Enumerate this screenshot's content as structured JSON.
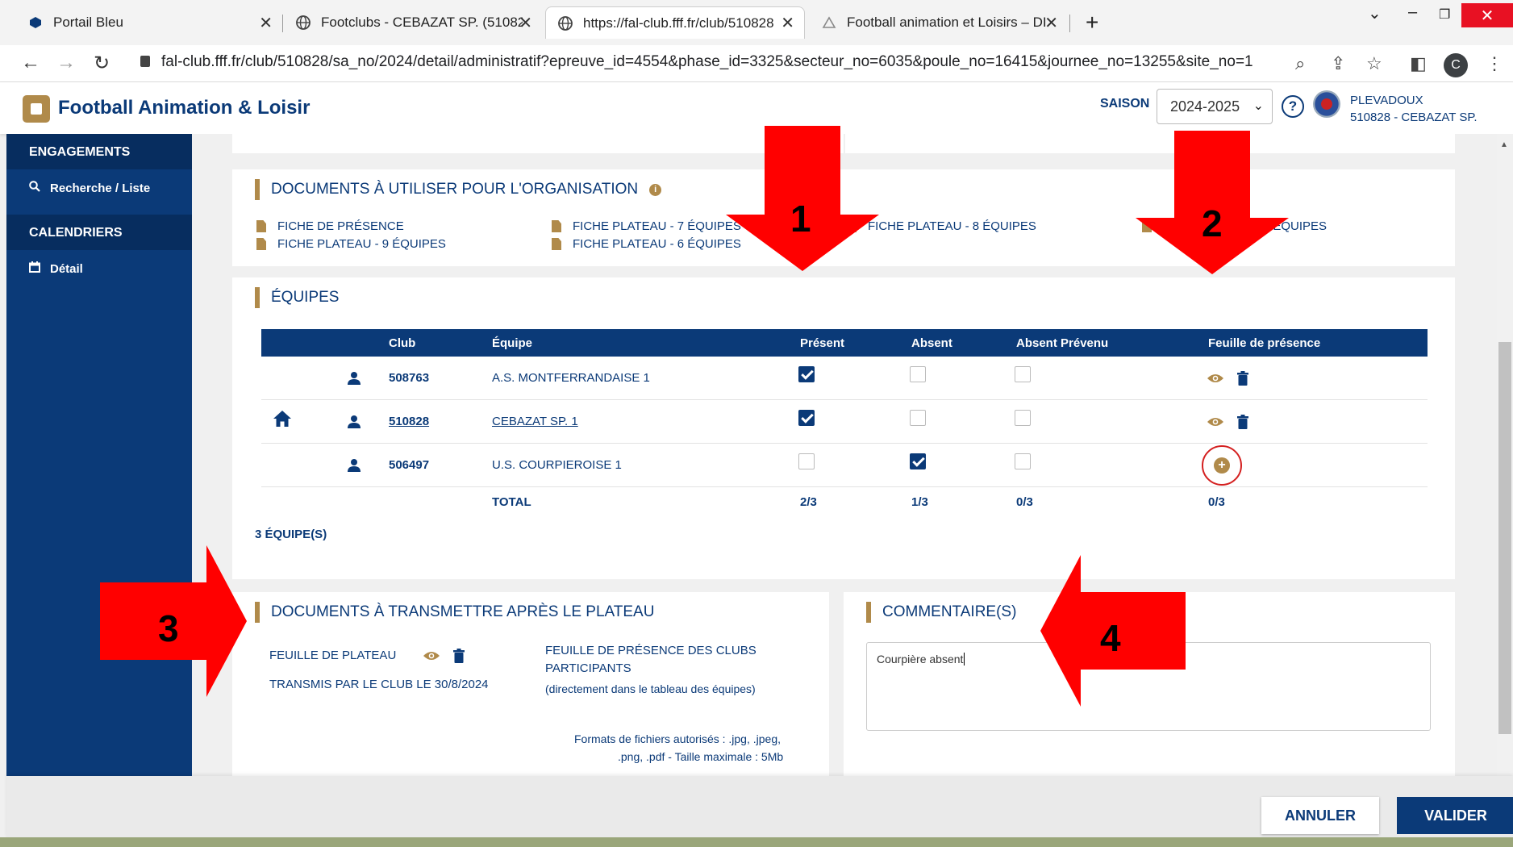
{
  "browser": {
    "tabs": [
      {
        "title": "Portail Bleu"
      },
      {
        "title": "Footclubs - CEBAZAT SP. (510828"
      },
      {
        "title": "https://fal-club.fff.fr/club/510828"
      },
      {
        "title": "Football animation et Loisirs – DI"
      }
    ],
    "url": "fal-club.fff.fr/club/510828/sa_no/2024/detail/administratif?epreuve_id=4554&phase_id=3325&secteur_no=6035&poule_no=16415&journee_no=13255&site_no=1",
    "profile_initial": "C"
  },
  "header": {
    "title": "Football Animation & Loisir",
    "saison_label": "SAISON",
    "saison_value": "2024-2025",
    "user_name": "PLEVADOUX",
    "user_club": "510828 - CEBAZAT SP."
  },
  "sidebar": {
    "section1": "ENGAGEMENTS",
    "item1": "Recherche / Liste",
    "section2": "CALENDRIERS",
    "item2": "Détail"
  },
  "organisation": {
    "title": "DOCUMENTS À UTILISER POUR L'ORGANISATION",
    "docs": [
      "FICHE DE PRÉSENCE",
      "FICHE PLATEAU - 9 ÉQUIPES",
      "FICHE PLATEAU - 7 ÉQUIPES",
      "FICHE PLATEAU - 6 ÉQUIPES",
      "FICHE PLATEAU - 8 ÉQUIPES",
      "FI",
      "U - 10 ÉQUIPES"
    ]
  },
  "equipes": {
    "title": "ÉQUIPES",
    "columns": [
      "Club",
      "Équipe",
      "Présent",
      "Absent",
      "Absent Prévenu",
      "Feuille de présence"
    ],
    "rows": [
      {
        "club": "508763",
        "equipe": "A.S. MONTFERRANDAISE 1",
        "present": true,
        "absent": false,
        "prevenu": false,
        "home": false,
        "has_sheet": true
      },
      {
        "club": "510828",
        "equipe": "CEBAZAT SP. 1",
        "present": true,
        "absent": false,
        "prevenu": false,
        "home": true,
        "has_sheet": true
      },
      {
        "club": "506497",
        "equipe": "U.S. COURPIEROISE 1",
        "present": false,
        "absent": true,
        "prevenu": false,
        "home": false,
        "has_sheet": false
      }
    ],
    "total_label": "TOTAL",
    "totals": {
      "present": "2/3",
      "absent": "1/3",
      "prevenu": "0/3",
      "feuille": "0/3"
    },
    "count_label": "3 ÉQUIPE(S)"
  },
  "transmettre": {
    "title": "DOCUMENTS À TRANSMETTRE APRÈS LE PLATEAU",
    "feuille_label": "FEUILLE DE PLATEAU",
    "transmis": "TRANSMIS PAR LE CLUB LE 30/8/2024",
    "presence_line1": "FEUILLE DE PRÉSENCE DES CLUBS",
    "presence_line2": "PARTICIPANTS",
    "presence_note": "(directement dans le tableau des équipes)",
    "formats_line1": "Formats de fichiers autorisés : .jpg, .jpeg,",
    "formats_line2": ".png, .pdf - Taille maximale : 5Mb"
  },
  "commentaires": {
    "title": "COMMENTAIRE(S)",
    "value": "Courpière absent"
  },
  "footer": {
    "annuler": "ANNULER",
    "valider": "VALIDER"
  },
  "annotations": {
    "n1": "1",
    "n2": "2",
    "n3": "3",
    "n4": "4",
    "arrow_color": "#ff0000"
  },
  "colors": {
    "brand_blue": "#0b3a78",
    "accent_gold": "#b08a4a"
  }
}
